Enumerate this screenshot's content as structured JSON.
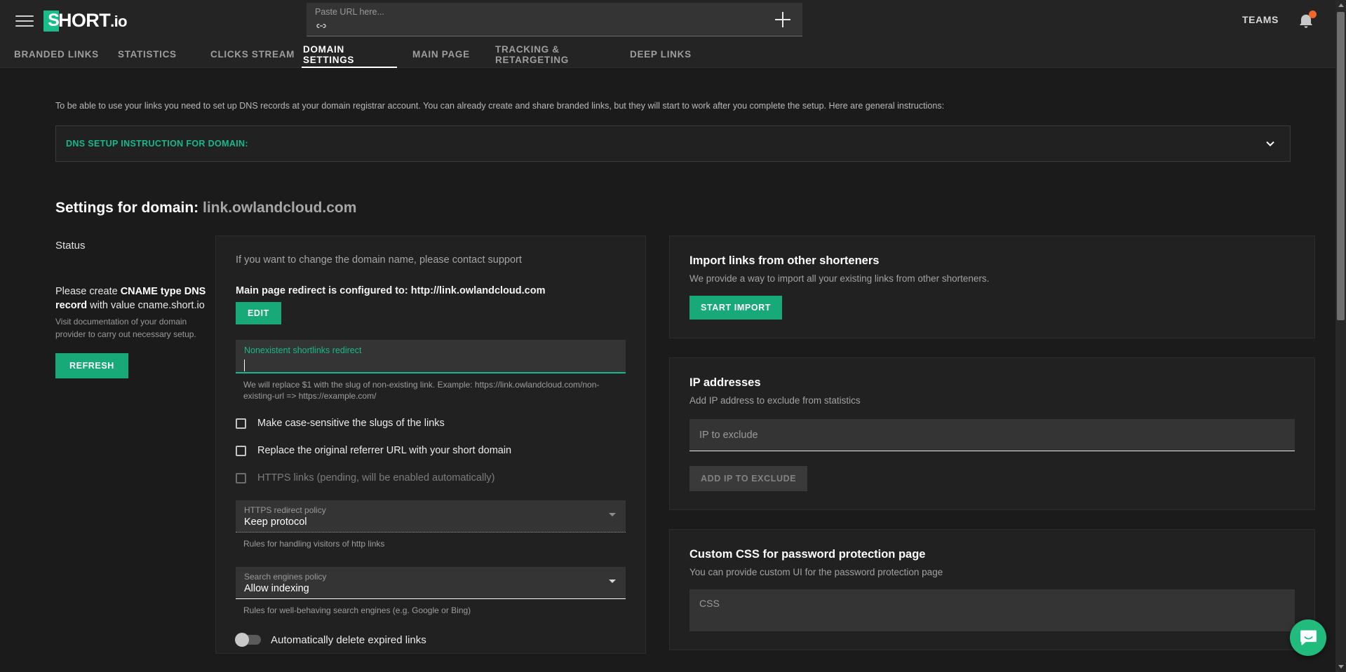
{
  "header": {
    "menu_icon": "hamburger-menu-icon",
    "logo_mark": "S",
    "logo_text": "HORT",
    "logo_suffix": ".io",
    "url_input": {
      "label": "Paste URL here...",
      "value": "",
      "link_icon": "link-icon",
      "add_icon": "plus-icon"
    },
    "teams_label": "TEAMS",
    "notifications_icon": "bell-icon",
    "notification_badge": ""
  },
  "tabs": [
    {
      "label": "BRANDED LINKS",
      "active": false
    },
    {
      "label": "STATISTICS",
      "active": false
    },
    {
      "label": "CLICKS STREAM",
      "active": false
    },
    {
      "label": "DOMAIN SETTINGS",
      "active": true
    },
    {
      "label": "MAIN PAGE",
      "active": false
    },
    {
      "label": "TRACKING & RETARGETING",
      "active": false
    },
    {
      "label": "DEEP LINKS",
      "active": false
    }
  ],
  "intro": {
    "text": "To be able to use your links you need to set up DNS records at your domain registrar account. You can already create and share branded links, but they will start to work after you complete the setup. Here are general instructions:"
  },
  "dns_panel": {
    "label": "DNS SETUP INSTRUCTION FOR DOMAIN:",
    "expand_icon": "chevron-down-icon"
  },
  "page_title": {
    "prefix": "Settings for domain:",
    "domain": "link.owlandcloud.com"
  },
  "status": {
    "heading": "Status",
    "message_prefix": "Please create ",
    "message_bold": "CNAME type DNS record",
    "message_suffix": " with value cname.short.io",
    "sub": "Visit documentation of your domain provider to carry out necessary setup.",
    "refresh_label": "REFRESH"
  },
  "main_card": {
    "contact_support": "If you want to change the domain name, please contact support",
    "redirect_line": "Main page redirect is configured to: http://link.owlandcloud.com",
    "edit_label": "EDIT",
    "nonexistent_field": {
      "label": "Nonexistent shortlinks redirect",
      "value": ""
    },
    "nonexistent_helper": "We will replace $1 with the slug of non-existing link. Example: https://link.owlandcloud.com/non-existing-url => https://example.com/",
    "checkboxes": [
      {
        "label": "Make case-sensitive the slugs of the links",
        "checked": false,
        "disabled": false
      },
      {
        "label": "Replace the original referrer URL with your short domain",
        "checked": false,
        "disabled": false
      },
      {
        "label": "HTTPS links (pending, will be enabled automatically)",
        "checked": false,
        "disabled": true
      }
    ],
    "https_policy": {
      "label": "HTTPS redirect policy",
      "value": "Keep protocol",
      "helper": "Rules for handling visitors of http links"
    },
    "search_policy": {
      "label": "Search engines policy",
      "value": "Allow indexing",
      "helper": "Rules for well-behaving search engines (e.g. Google or Bing)"
    },
    "auto_delete": {
      "label": "Automatically delete expired links",
      "enabled": false
    }
  },
  "side_cards": {
    "import": {
      "title": "Import links from other shorteners",
      "subtitle": "We provide a way to import all your existing links from other shorteners.",
      "button_label": "START IMPORT"
    },
    "ip": {
      "title": "IP addresses",
      "subtitle": "Add IP address to exclude from statistics",
      "input_placeholder": "IP to exclude",
      "input_value": "",
      "button_label": "ADD IP TO EXCLUDE"
    },
    "css": {
      "title": "Custom CSS for password protection page",
      "subtitle": "You can provide custom UI for the password protection page",
      "textarea_placeholder": "CSS",
      "textarea_value": ""
    }
  },
  "chat": {
    "icon": "intercom-chat-icon"
  },
  "colors": {
    "accent_green": "#17b98a",
    "button_green": "#17a977",
    "badge_orange": "#f0662c",
    "background": "#1b1b1b",
    "surface": "#212121",
    "field": "#343434"
  }
}
